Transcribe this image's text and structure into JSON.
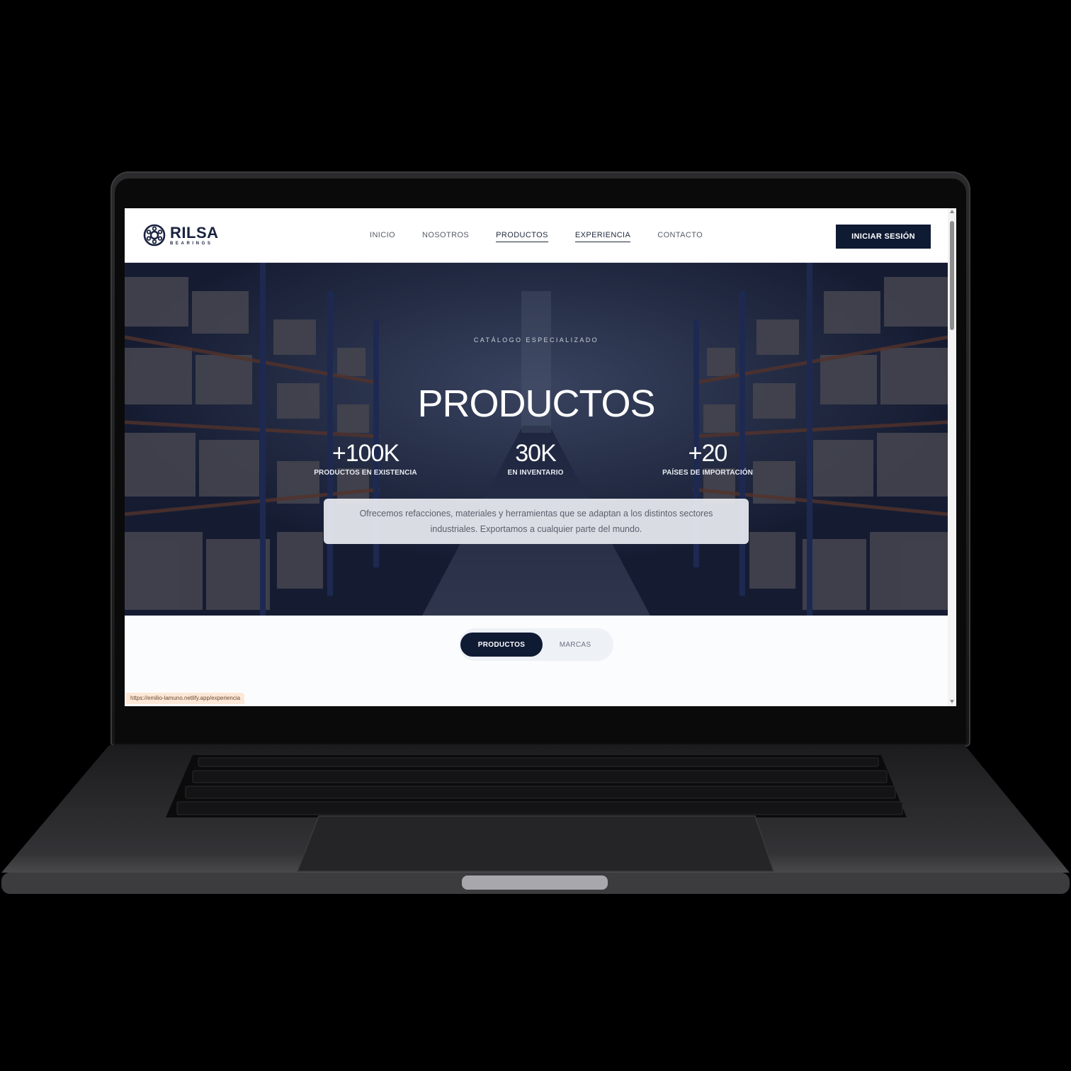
{
  "site": {
    "logo": {
      "name": "RILSA",
      "sub": "BEARINGS",
      "icon": "bearing-icon"
    },
    "nav": [
      {
        "label": "INICIO",
        "active": false
      },
      {
        "label": "NOSOTROS",
        "active": false
      },
      {
        "label": "PRODUCTOS",
        "active": true
      },
      {
        "label": "EXPERIENCIA",
        "active": true
      },
      {
        "label": "CONTACTO",
        "active": false
      }
    ],
    "login_label": "INICIAR SESIÓN"
  },
  "hero": {
    "eyebrow": "CATÁLOGO ESPECIALIZADO",
    "title": "PRODUCTOS",
    "stats": [
      {
        "value": "+100K",
        "label": "PRODUCTOS EN EXISTENCIA"
      },
      {
        "value": "30K",
        "label": "EN INVENTARIO"
      },
      {
        "value": "+20",
        "label": "PAÍSES DE IMPORTACIÓN"
      }
    ],
    "description": "Ofrecemos refacciones, materiales y herramientas que se adaptan a los distintos sectores industriales. Exportamos a cualquier parte del mundo."
  },
  "tabs": [
    {
      "label": "PRODUCTOS",
      "selected": true
    },
    {
      "label": "MARCAS",
      "selected": false
    }
  ],
  "status_bar_url": "https://emilio-lamuno.netlify.app/experiencia",
  "colors": {
    "navy": "#0f1a33",
    "page_bg": "#fbfcfd",
    "tab_track": "#eef1f6"
  }
}
